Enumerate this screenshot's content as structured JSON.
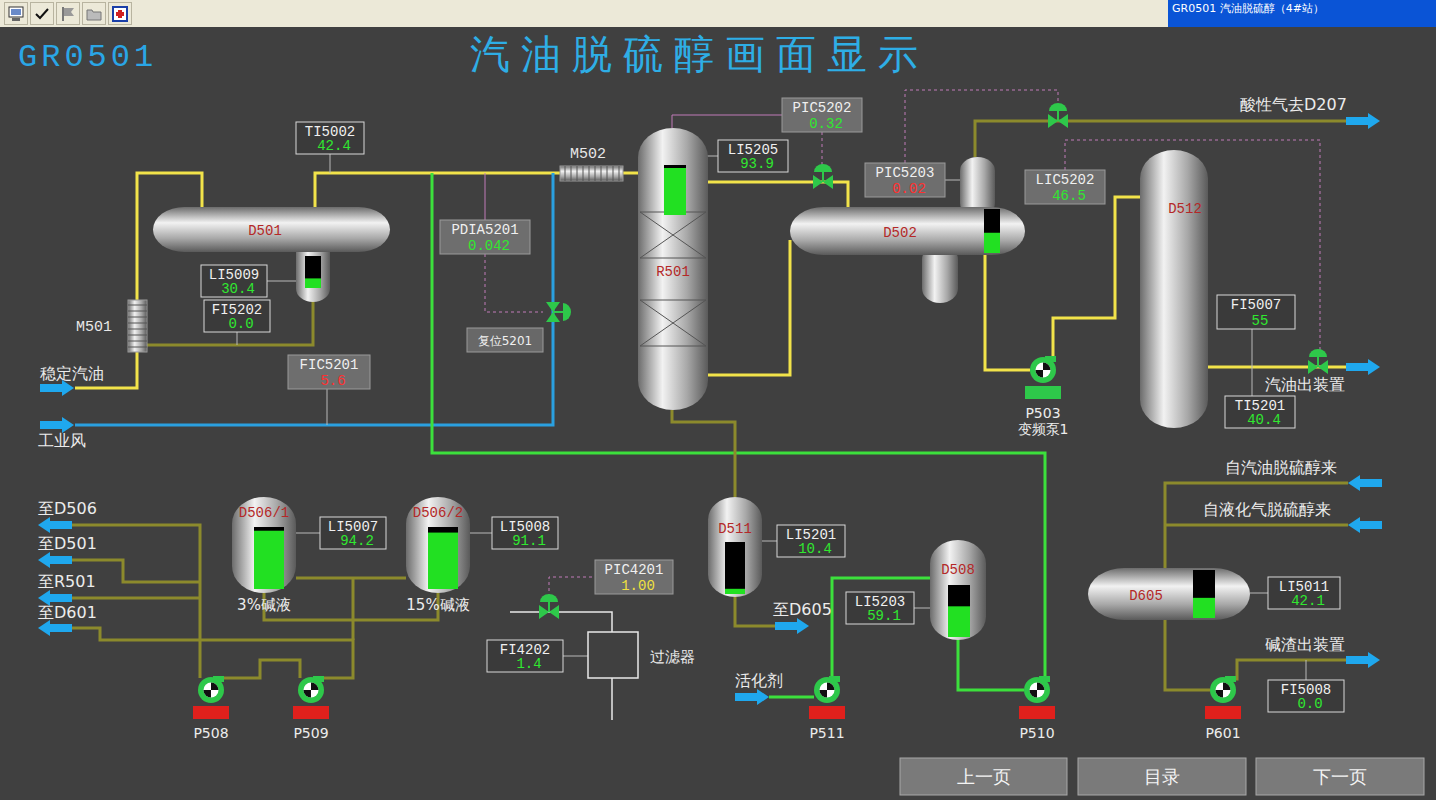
{
  "toolbar": {
    "title": "GR0501 汽油脱硫醇（4#站）"
  },
  "header": {
    "code": "GR0501",
    "title": "汽油脱硫醇画面显示"
  },
  "instruments": [
    {
      "tag": "TI5002",
      "value": "42.4",
      "kind": "indicator",
      "color": "#30e830"
    },
    {
      "tag": "LI5009",
      "value": "30.4",
      "kind": "indicator",
      "color": "#30e830"
    },
    {
      "tag": "FI5202",
      "value": "0.0",
      "kind": "indicator",
      "color": "#30e830"
    },
    {
      "tag": "FIC5201",
      "value": "5.6",
      "kind": "controller",
      "color": "#ff3030"
    },
    {
      "tag": "PDIA5201",
      "value": "0.042",
      "kind": "controller",
      "color": "#30e830"
    },
    {
      "tag": "PIC5202",
      "value": "0.32",
      "kind": "controller",
      "color": "#30e830"
    },
    {
      "tag": "LI5205",
      "value": "93.9",
      "kind": "indicator",
      "color": "#30e830"
    },
    {
      "tag": "PIC5203",
      "value": "0.02",
      "kind": "controller",
      "color": "#ff3030"
    },
    {
      "tag": "LIC5202",
      "value": "46.5",
      "kind": "controller",
      "color": "#30e830"
    },
    {
      "tag": "FI5007",
      "value": "55",
      "kind": "indicator",
      "color": "#30e830"
    },
    {
      "tag": "TI5201",
      "value": "40.4",
      "kind": "indicator",
      "color": "#30e830"
    },
    {
      "tag": "LI5007",
      "value": "94.2",
      "kind": "indicator",
      "color": "#30e830"
    },
    {
      "tag": "LI5008",
      "value": "91.1",
      "kind": "indicator",
      "color": "#30e830"
    },
    {
      "tag": "PIC4201",
      "value": "1.00",
      "kind": "controller",
      "color": "#f0e040"
    },
    {
      "tag": "FI4202",
      "value": "1.4",
      "kind": "indicator",
      "color": "#30e830"
    },
    {
      "tag": "LI5201",
      "value": "10.4",
      "kind": "indicator",
      "color": "#30e830"
    },
    {
      "tag": "LI5203",
      "value": "59.1",
      "kind": "indicator",
      "color": "#30e830"
    },
    {
      "tag": "LI5011",
      "value": "42.1",
      "kind": "indicator",
      "color": "#30e830"
    },
    {
      "tag": "FI5008",
      "value": "0.0",
      "kind": "indicator",
      "color": "#30e830"
    }
  ],
  "vessels": [
    {
      "name": "D501",
      "level": 0.3
    },
    {
      "name": "R501",
      "level": 0.94
    },
    {
      "name": "D502",
      "level": 0.46
    },
    {
      "name": "D512"
    },
    {
      "name": "D506/1",
      "level": 0.94,
      "caption": "3%碱液"
    },
    {
      "name": "D506/2",
      "level": 0.91,
      "caption": "15%碱液"
    },
    {
      "name": "D511",
      "level": 0.1
    },
    {
      "name": "D508",
      "level": 0.59
    },
    {
      "name": "D605",
      "level": 0.42
    }
  ],
  "mixers": [
    {
      "name": "M501"
    },
    {
      "name": "M502"
    }
  ],
  "pumps": [
    {
      "name": "P503",
      "note": "变频泵1",
      "running": true
    },
    {
      "name": "P508",
      "running": false
    },
    {
      "name": "P509",
      "running": false
    },
    {
      "name": "P511",
      "running": false
    },
    {
      "name": "P510",
      "running": false
    },
    {
      "name": "P601",
      "running": false
    }
  ],
  "streams": [
    {
      "label": "稳定汽油"
    },
    {
      "label": "工业风"
    },
    {
      "label": "酸性气去D207"
    },
    {
      "label": "汽油出装置"
    },
    {
      "label": "自汽油脱硫醇来"
    },
    {
      "label": "自液化气脱硫醇来"
    },
    {
      "label": "碱渣出装置"
    },
    {
      "label": "至D506"
    },
    {
      "label": "至D501"
    },
    {
      "label": "至R501"
    },
    {
      "label": "至D601"
    },
    {
      "label": "至D605"
    },
    {
      "label": "活化剂"
    }
  ],
  "filter": {
    "label": "过滤器"
  },
  "reset_button": {
    "label": "复位5201"
  },
  "nav": [
    {
      "label": "上一页"
    },
    {
      "label": "目录"
    },
    {
      "label": "下一页"
    }
  ]
}
